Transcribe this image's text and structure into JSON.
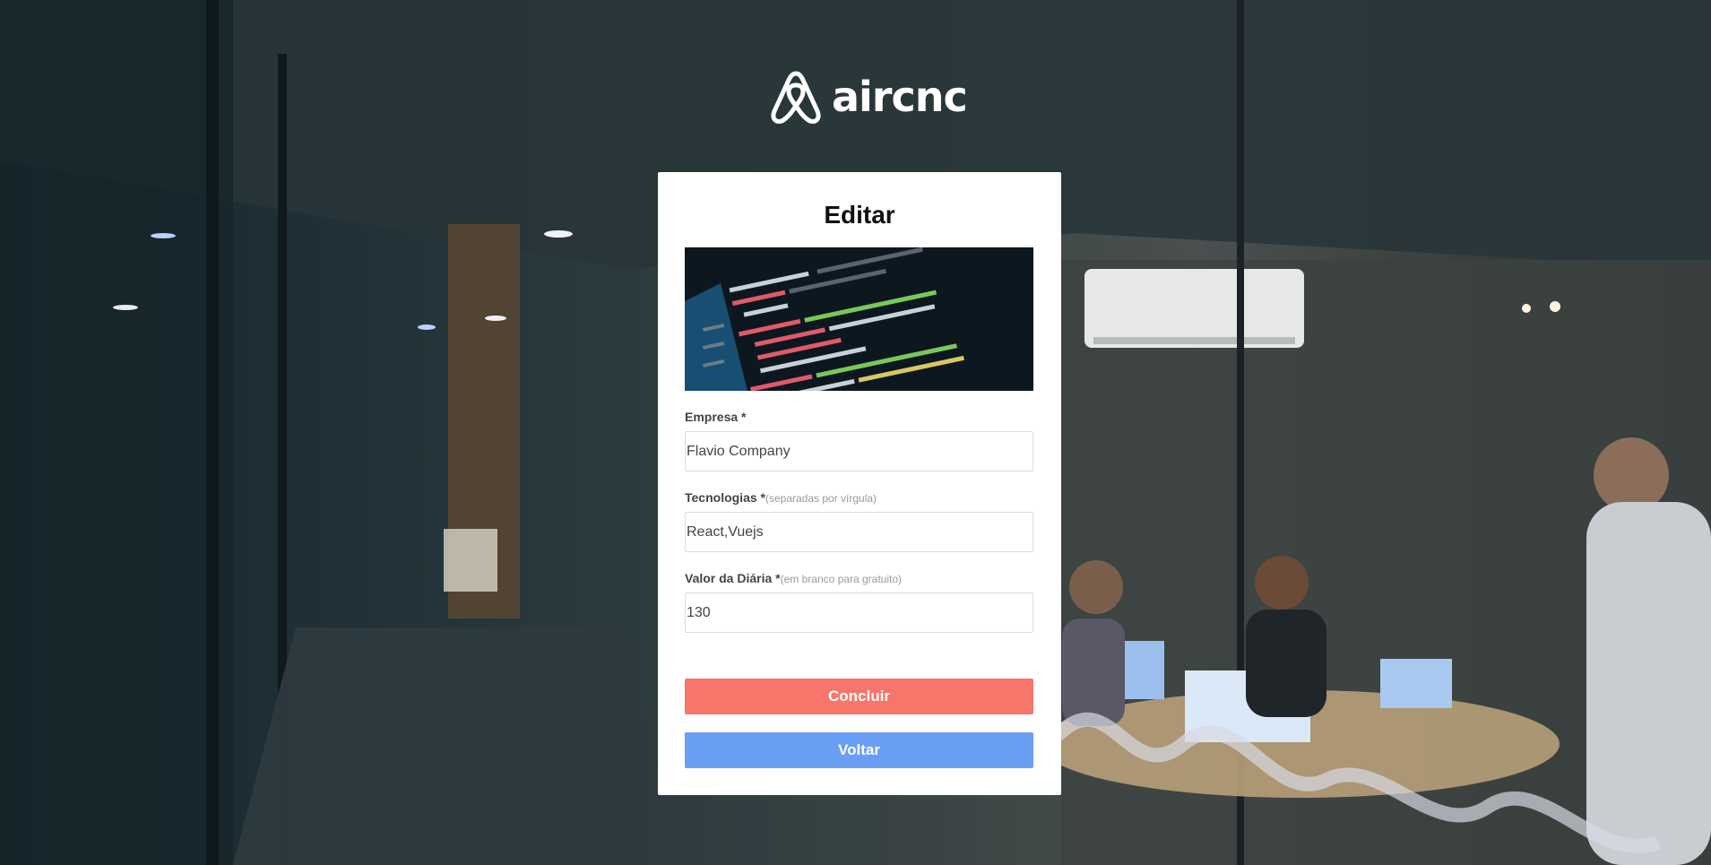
{
  "brand": {
    "name": "aircnc",
    "logo_icon": "airbnb-belo-icon"
  },
  "form": {
    "title": "Editar",
    "thumbnail_icon": "code-screenshot-image",
    "fields": [
      {
        "label": "Empresa *",
        "hint": "",
        "value": "Flavio Company"
      },
      {
        "label": "Tecnologias *",
        "hint": "(separadas por vírgula)",
        "value": "React,Vuejs"
      },
      {
        "label": "Valor da Diária *",
        "hint": "(em branco para gratuito)",
        "value": "130"
      }
    ],
    "submit_label": "Concluir",
    "back_label": "Voltar"
  },
  "colors": {
    "primary_button": "#f6766c",
    "secondary_button": "#6a9ef5",
    "card_background": "#ffffff"
  }
}
